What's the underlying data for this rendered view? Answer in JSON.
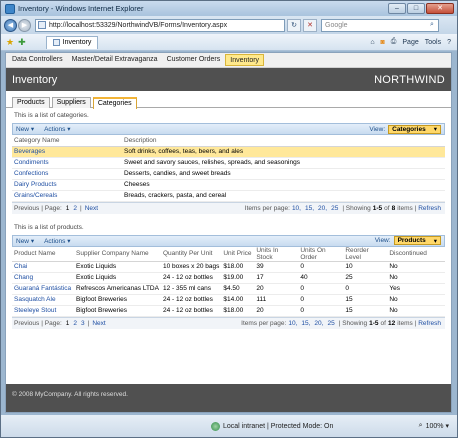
{
  "window": {
    "title": "Inventory - Windows Internet Explorer",
    "address": "http://localhost:53329/NorthwindVB/Forms/Inventory.aspx",
    "search_placeholder": "Google",
    "fav_tab": "Inventory",
    "cmd": {
      "page": "Page",
      "tools": "Tools"
    }
  },
  "menu": [
    "Data Controllers",
    "Master/Detail Extravaganza",
    "Customer Orders",
    "Inventory"
  ],
  "header": {
    "title": "Inventory",
    "brand": "NORTHWIND"
  },
  "tabs": [
    "Products",
    "Suppliers",
    "Categories"
  ],
  "categories": {
    "description": "This is a list of categories.",
    "new_label": "New",
    "actions_label": "Actions",
    "view_label": "View:",
    "view_value": "Categories",
    "columns": [
      "Category Name",
      "Description"
    ],
    "rows": [
      [
        "Beverages",
        "Soft drinks, coffees, teas, beers, and ales"
      ],
      [
        "Condiments",
        "Sweet and savory sauces, relishes, spreads, and seasonings"
      ],
      [
        "Confections",
        "Desserts, candies, and sweet breads"
      ],
      [
        "Dairy Products",
        "Cheeses"
      ],
      [
        "Grains/Cereals",
        "Breads, crackers, pasta, and cereal"
      ]
    ],
    "pager": {
      "previous": "Previous",
      "page_label": "| Page:",
      "current": "1",
      "pages": [
        "2"
      ],
      "next": "Next",
      "items_per_page": "Items per page:",
      "sizes": [
        "10,",
        "15,",
        "20,",
        "25"
      ],
      "showing_prefix": "| Showing",
      "range": "1-5",
      "of": "of",
      "total": "8",
      "items": "items |",
      "refresh": "Refresh"
    }
  },
  "products": {
    "description": "This is a list of products.",
    "new_label": "New",
    "actions_label": "Actions",
    "view_label": "View:",
    "view_value": "Products",
    "columns": [
      "Product Name",
      "Supplier Company Name",
      "Quantity Per Unit",
      "Unit Price",
      "Units In Stock",
      "Units On Order",
      "Reorder Level",
      "Discontinued"
    ],
    "rows": [
      [
        "Chai",
        "Exotic Liquids",
        "10 boxes x 20 bags",
        "$18.00",
        "39",
        "0",
        "10",
        "No"
      ],
      [
        "Chang",
        "Exotic Liquids",
        "24 - 12 oz bottles",
        "$19.00",
        "17",
        "40",
        "25",
        "No"
      ],
      [
        "Guaraná Fantástica",
        "Refrescos Americanas LTDA",
        "12 - 355 ml cans",
        "$4.50",
        "20",
        "0",
        "0",
        "Yes"
      ],
      [
        "Sasquatch Ale",
        "Bigfoot Breweries",
        "24 - 12 oz bottles",
        "$14.00",
        "111",
        "0",
        "15",
        "No"
      ],
      [
        "Steeleye Stout",
        "Bigfoot Breweries",
        "24 - 12 oz bottles",
        "$18.00",
        "20",
        "0",
        "15",
        "No"
      ]
    ],
    "pager": {
      "previous": "Previous",
      "page_label": "| Page:",
      "current": "1",
      "pages": [
        "2",
        "3"
      ],
      "next": "Next",
      "items_per_page": "Items per page:",
      "sizes": [
        "10,",
        "15,",
        "20,",
        "25"
      ],
      "showing_prefix": "| Showing",
      "range": "1-5",
      "of": "of",
      "total": "12",
      "items": "items |",
      "refresh": "Refresh"
    }
  },
  "footer": "© 2008 MyCompany. All rights reserved.",
  "status": {
    "left": "",
    "zone": "Local intranet | Protected Mode: On",
    "zoom": "100%"
  }
}
